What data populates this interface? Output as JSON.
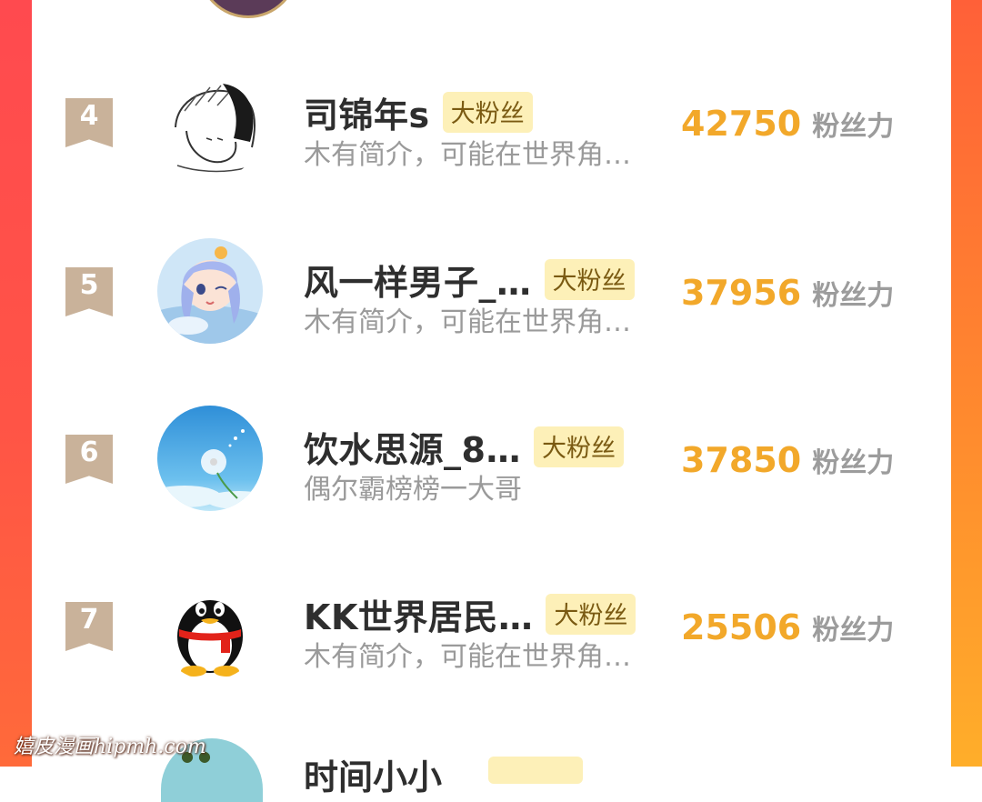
{
  "list": {
    "rows": [
      {
        "rank": "4",
        "name": "司锦年s",
        "badge": "大粉丝",
        "description": "木有简介，可能在世界角…",
        "score": "42750",
        "score_unit": "粉丝力",
        "avatar_icon": "sketch-boy-avatar"
      },
      {
        "rank": "5",
        "name": "风一样男子_…",
        "badge": "大粉丝",
        "description": "木有简介，可能在世界角…",
        "score": "37956",
        "score_unit": "粉丝力",
        "avatar_icon": "cartoon-girl-avatar"
      },
      {
        "rank": "6",
        "name": "饮水思源_8…",
        "badge": "大粉丝",
        "description": "偶尔霸榜榜一大哥",
        "score": "37850",
        "score_unit": "粉丝力",
        "avatar_icon": "dandelion-avatar"
      },
      {
        "rank": "7",
        "name": "KK世界居民…",
        "badge": "大粉丝",
        "description": "木有简介，可能在世界角…",
        "score": "25506",
        "score_unit": "粉丝力",
        "avatar_icon": "qq-penguin-avatar"
      }
    ],
    "partial_next": {
      "name": "时间小小"
    }
  },
  "watermark": "嬉皮漫画hipmh.com",
  "colors": {
    "score": "#f2a82a",
    "badge_bg": "#fdf0b8",
    "rank_bg": "#c9b29a",
    "side_left": "#ff4a4f",
    "side_right": "#ff8a2e"
  }
}
